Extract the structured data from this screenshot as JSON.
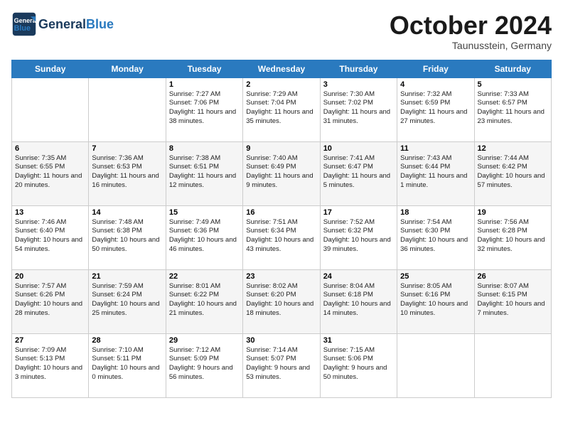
{
  "logo": {
    "text_general": "General",
    "text_blue": "Blue"
  },
  "header": {
    "month": "October 2024",
    "location": "Taunusstein, Germany"
  },
  "weekdays": [
    "Sunday",
    "Monday",
    "Tuesday",
    "Wednesday",
    "Thursday",
    "Friday",
    "Saturday"
  ],
  "weeks": [
    [
      {
        "day": "",
        "detail": ""
      },
      {
        "day": "",
        "detail": ""
      },
      {
        "day": "1",
        "detail": "Sunrise: 7:27 AM\nSunset: 7:06 PM\nDaylight: 11 hours\nand 38 minutes."
      },
      {
        "day": "2",
        "detail": "Sunrise: 7:29 AM\nSunset: 7:04 PM\nDaylight: 11 hours\nand 35 minutes."
      },
      {
        "day": "3",
        "detail": "Sunrise: 7:30 AM\nSunset: 7:02 PM\nDaylight: 11 hours\nand 31 minutes."
      },
      {
        "day": "4",
        "detail": "Sunrise: 7:32 AM\nSunset: 6:59 PM\nDaylight: 11 hours\nand 27 minutes."
      },
      {
        "day": "5",
        "detail": "Sunrise: 7:33 AM\nSunset: 6:57 PM\nDaylight: 11 hours\nand 23 minutes."
      }
    ],
    [
      {
        "day": "6",
        "detail": "Sunrise: 7:35 AM\nSunset: 6:55 PM\nDaylight: 11 hours\nand 20 minutes."
      },
      {
        "day": "7",
        "detail": "Sunrise: 7:36 AM\nSunset: 6:53 PM\nDaylight: 11 hours\nand 16 minutes."
      },
      {
        "day": "8",
        "detail": "Sunrise: 7:38 AM\nSunset: 6:51 PM\nDaylight: 11 hours\nand 12 minutes."
      },
      {
        "day": "9",
        "detail": "Sunrise: 7:40 AM\nSunset: 6:49 PM\nDaylight: 11 hours\nand 9 minutes."
      },
      {
        "day": "10",
        "detail": "Sunrise: 7:41 AM\nSunset: 6:47 PM\nDaylight: 11 hours\nand 5 minutes."
      },
      {
        "day": "11",
        "detail": "Sunrise: 7:43 AM\nSunset: 6:44 PM\nDaylight: 11 hours\nand 1 minute."
      },
      {
        "day": "12",
        "detail": "Sunrise: 7:44 AM\nSunset: 6:42 PM\nDaylight: 10 hours\nand 57 minutes."
      }
    ],
    [
      {
        "day": "13",
        "detail": "Sunrise: 7:46 AM\nSunset: 6:40 PM\nDaylight: 10 hours\nand 54 minutes."
      },
      {
        "day": "14",
        "detail": "Sunrise: 7:48 AM\nSunset: 6:38 PM\nDaylight: 10 hours\nand 50 minutes."
      },
      {
        "day": "15",
        "detail": "Sunrise: 7:49 AM\nSunset: 6:36 PM\nDaylight: 10 hours\nand 46 minutes."
      },
      {
        "day": "16",
        "detail": "Sunrise: 7:51 AM\nSunset: 6:34 PM\nDaylight: 10 hours\nand 43 minutes."
      },
      {
        "day": "17",
        "detail": "Sunrise: 7:52 AM\nSunset: 6:32 PM\nDaylight: 10 hours\nand 39 minutes."
      },
      {
        "day": "18",
        "detail": "Sunrise: 7:54 AM\nSunset: 6:30 PM\nDaylight: 10 hours\nand 36 minutes."
      },
      {
        "day": "19",
        "detail": "Sunrise: 7:56 AM\nSunset: 6:28 PM\nDaylight: 10 hours\nand 32 minutes."
      }
    ],
    [
      {
        "day": "20",
        "detail": "Sunrise: 7:57 AM\nSunset: 6:26 PM\nDaylight: 10 hours\nand 28 minutes."
      },
      {
        "day": "21",
        "detail": "Sunrise: 7:59 AM\nSunset: 6:24 PM\nDaylight: 10 hours\nand 25 minutes."
      },
      {
        "day": "22",
        "detail": "Sunrise: 8:01 AM\nSunset: 6:22 PM\nDaylight: 10 hours\nand 21 minutes."
      },
      {
        "day": "23",
        "detail": "Sunrise: 8:02 AM\nSunset: 6:20 PM\nDaylight: 10 hours\nand 18 minutes."
      },
      {
        "day": "24",
        "detail": "Sunrise: 8:04 AM\nSunset: 6:18 PM\nDaylight: 10 hours\nand 14 minutes."
      },
      {
        "day": "25",
        "detail": "Sunrise: 8:05 AM\nSunset: 6:16 PM\nDaylight: 10 hours\nand 10 minutes."
      },
      {
        "day": "26",
        "detail": "Sunrise: 8:07 AM\nSunset: 6:15 PM\nDaylight: 10 hours\nand 7 minutes."
      }
    ],
    [
      {
        "day": "27",
        "detail": "Sunrise: 7:09 AM\nSunset: 5:13 PM\nDaylight: 10 hours\nand 3 minutes."
      },
      {
        "day": "28",
        "detail": "Sunrise: 7:10 AM\nSunset: 5:11 PM\nDaylight: 10 hours\nand 0 minutes."
      },
      {
        "day": "29",
        "detail": "Sunrise: 7:12 AM\nSunset: 5:09 PM\nDaylight: 9 hours\nand 56 minutes."
      },
      {
        "day": "30",
        "detail": "Sunrise: 7:14 AM\nSunset: 5:07 PM\nDaylight: 9 hours\nand 53 minutes."
      },
      {
        "day": "31",
        "detail": "Sunrise: 7:15 AM\nSunset: 5:06 PM\nDaylight: 9 hours\nand 50 minutes."
      },
      {
        "day": "",
        "detail": ""
      },
      {
        "day": "",
        "detail": ""
      }
    ]
  ]
}
